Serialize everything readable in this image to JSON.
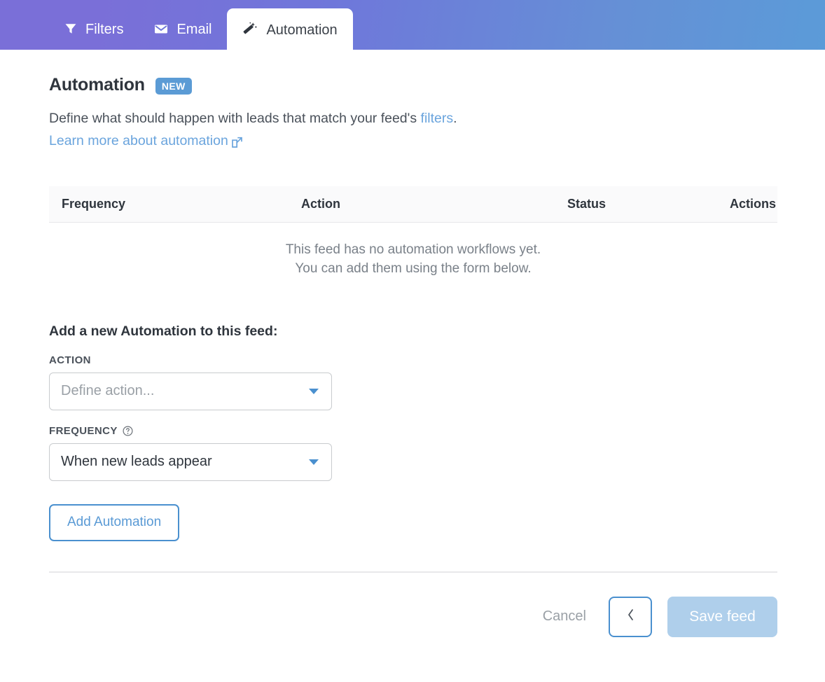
{
  "tabs": [
    {
      "id": "filters",
      "label": "Filters",
      "icon": "filter-icon",
      "active": false
    },
    {
      "id": "email",
      "label": "Email",
      "icon": "envelope-icon",
      "active": false
    },
    {
      "id": "automation",
      "label": "Automation",
      "icon": "magic-wand-icon",
      "active": true
    }
  ],
  "header": {
    "title": "Automation",
    "badge": "NEW"
  },
  "description": {
    "prefix": "Define what should happen with leads that match your feed's ",
    "link": "filters",
    "suffix": ".",
    "learn_more": "Learn more about automation",
    "learn_more_icon": "external-link-icon"
  },
  "table": {
    "columns": [
      "Frequency",
      "Action",
      "Status",
      "Actions"
    ],
    "rows": [],
    "empty_line1": "This feed has no automation workflows yet.",
    "empty_line2": "You can add them using the form below."
  },
  "form": {
    "title": "Add a new Automation to this feed:",
    "action": {
      "label": "ACTION",
      "value": "",
      "placeholder": "Define action...",
      "options": []
    },
    "frequency": {
      "label": "FREQUENCY",
      "help_icon": "help-circle-icon",
      "value": "When new leads appear",
      "options": [
        "When new leads appear"
      ]
    },
    "add_button": "Add Automation"
  },
  "footer": {
    "cancel": "Cancel",
    "back_icon": "chevron-left-icon",
    "save": "Save feed"
  },
  "colors": {
    "gradient_start": "#7a6fd8",
    "gradient_end": "#5b9bd8",
    "accent_blue": "#4a90cf",
    "link_blue": "#6aa4dd",
    "badge_blue": "#5b9bd5",
    "save_disabled": "#afcfeb"
  }
}
